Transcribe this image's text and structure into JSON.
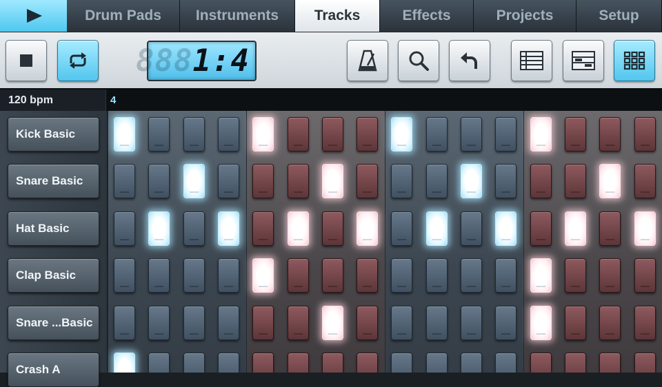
{
  "tabs": [
    {
      "label": "Drum Pads",
      "active": false
    },
    {
      "label": "Instruments",
      "active": false
    },
    {
      "label": "Tracks",
      "active": true
    },
    {
      "label": "Effects",
      "active": false
    },
    {
      "label": "Projects",
      "active": false
    },
    {
      "label": "Setup",
      "active": false
    }
  ],
  "toolbar": {
    "stop_icon": "stop-icon",
    "loop_icon": "loop-icon",
    "loop_active": true,
    "metronome_icon": "metronome-icon",
    "search_icon": "magnifier-icon",
    "undo_icon": "undo-icon",
    "view_icons": [
      "list-view-icon",
      "piano-roll-view-icon",
      "grid-view-icon"
    ],
    "active_view": "grid-view-icon"
  },
  "position_display": {
    "ghost": "888",
    "value": "1:4"
  },
  "sequencer": {
    "bpm": "120 bpm",
    "bar_number": "4",
    "tracks": [
      {
        "name": "Kick Basic",
        "steps": [
          1,
          0,
          0,
          0,
          1,
          0,
          0,
          0,
          1,
          0,
          0,
          0,
          1,
          0,
          0,
          0
        ]
      },
      {
        "name": "Snare Basic",
        "steps": [
          0,
          0,
          1,
          0,
          0,
          0,
          1,
          0,
          0,
          0,
          1,
          0,
          0,
          0,
          1,
          0
        ]
      },
      {
        "name": "Hat Basic",
        "steps": [
          0,
          1,
          0,
          1,
          0,
          1,
          0,
          1,
          0,
          1,
          0,
          1,
          0,
          1,
          0,
          1
        ]
      },
      {
        "name": "Clap Basic",
        "steps": [
          0,
          0,
          0,
          0,
          1,
          0,
          0,
          0,
          0,
          0,
          0,
          0,
          1,
          0,
          0,
          0
        ]
      },
      {
        "name": "Snare ...Basic",
        "steps": [
          0,
          0,
          0,
          0,
          0,
          0,
          1,
          0,
          0,
          0,
          0,
          0,
          1,
          0,
          0,
          0
        ]
      },
      {
        "name": "Crash A",
        "steps": [
          1,
          0,
          0,
          0,
          0,
          0,
          0,
          0,
          0,
          0,
          0,
          0,
          0,
          0,
          0,
          0
        ]
      }
    ]
  },
  "colors": {
    "accent": "#52c6ee",
    "pad_blue_off": "#4a5a6a",
    "pad_red_off": "#6f4145",
    "pad_on": "#ffffff"
  }
}
